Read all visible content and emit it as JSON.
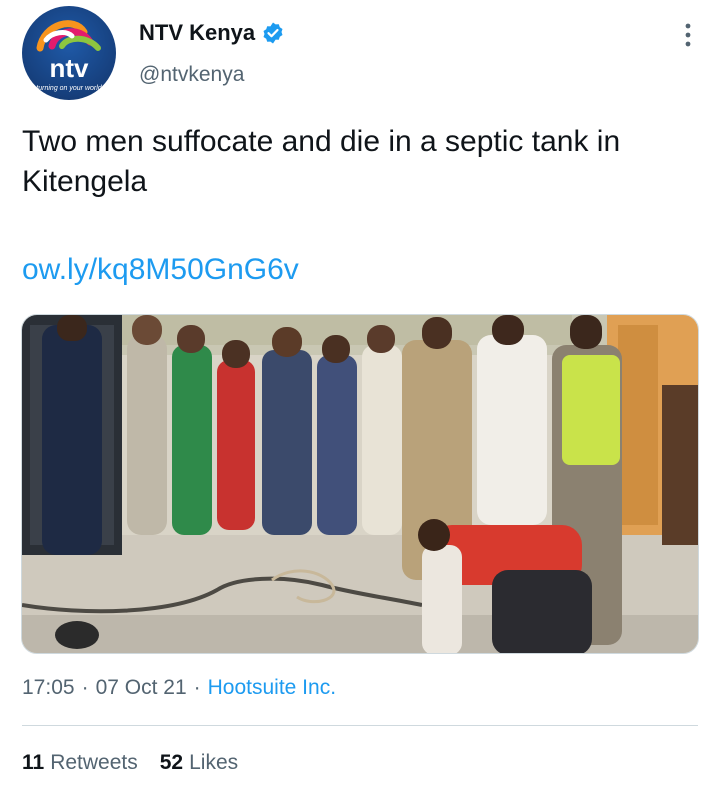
{
  "author": {
    "name": "NTV Kenya",
    "handle": "@ntvkenya",
    "verified": true,
    "avatar_logo_text": "ntv",
    "avatar_tagline": "turning on your world"
  },
  "tweet": {
    "text": "Two men suffocate and die in a septic tank in Kitengela",
    "link": "ow.ly/kq8M50GnG6v",
    "media_alt": "Crowd watching as a person in a red vest kneels at an open septic tank"
  },
  "meta": {
    "time": "17:05",
    "separator": "·",
    "date": "07 Oct 21",
    "source": "Hootsuite Inc."
  },
  "stats": {
    "retweets_count": "11",
    "retweets_label": "Retweets",
    "likes_count": "52",
    "likes_label": "Likes"
  },
  "colors": {
    "accent": "#1d9bf0",
    "secondary_text": "#536471",
    "verified": "#1d9bf0"
  },
  "icons": {
    "verified": "verified-badge-icon",
    "more": "more-options-icon"
  }
}
